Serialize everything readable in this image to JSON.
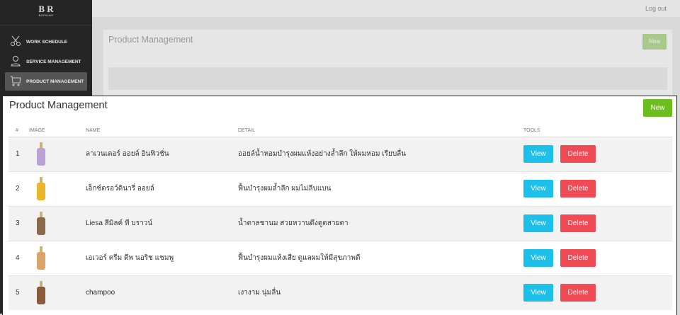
{
  "logo": {
    "text": "B R",
    "sub": "BOOKING"
  },
  "sidebar": {
    "items": [
      {
        "label": "WORK SCHEDULE",
        "icon": "scissors-icon"
      },
      {
        "label": "SERVICE MANAGEMENT",
        "icon": "user-icon"
      },
      {
        "label": "PRODUCT MANAGEMENT",
        "icon": "cart-icon",
        "active": true
      }
    ]
  },
  "header": {
    "logout": "Log out"
  },
  "page": {
    "title": "Product Management",
    "new_label": "New"
  },
  "table": {
    "headers": [
      "#",
      "IMAGE",
      "NAME",
      "DETAIL",
      "TOOLS"
    ],
    "rows": [
      {
        "no": "1",
        "name": "ลาเวนเดอร์ ออยล์ อินฟิวชั่น",
        "detail": "ออยล์น้ำหอมบำรุงผมแห้งอย่างล้ำลึก ให้ผมหอม เรียบลื่น",
        "color": "#b9a3d6"
      },
      {
        "no": "2",
        "name": "เอ็กซ์ตรอว์ดินารี่ ออยล์",
        "detail": "ฟื้นบำรุงผมล้ำลึก ผมไม่ลีบแบน",
        "color": "#e9b52a"
      },
      {
        "no": "3",
        "name": "Liesa สีมิลค์ ที บราวน์",
        "detail": "น้ำตาลชานม สวยหวานดึงดูดสายตา",
        "color": "#8a6a4a"
      },
      {
        "no": "4",
        "name": "เอเวอร์ ครีม ดีพ นอริช แชมพู",
        "detail": "ฟื้นบำรุงผมแห้งเสีย ดูแลผมให้มีสุขภาพดี",
        "color": "#d9a36a"
      },
      {
        "no": "5",
        "name": "champoo",
        "detail": "เงางาม นุ่มลื่น",
        "color": "#8a5a3a"
      }
    ],
    "view_label": "View",
    "delete_label": "Delete"
  }
}
